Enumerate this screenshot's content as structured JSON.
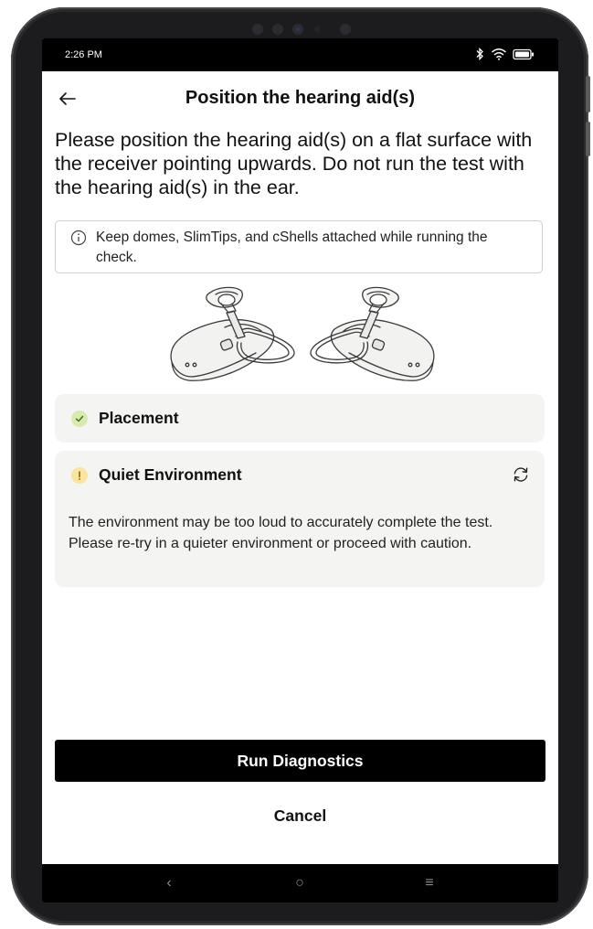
{
  "status_bar": {
    "time": "2:26 PM",
    "icons": [
      "bluetooth-icon",
      "wifi-icon",
      "battery-icon"
    ]
  },
  "header": {
    "back_icon": "arrow-left-icon",
    "title": "Position the hearing aid(s)"
  },
  "instructions": "Please position the hearing aid(s) on a flat surface with the receiver pointing upwards. Do not run the test with the hearing aid(s) in the ear.",
  "info": {
    "icon": "info-icon",
    "text": "Keep domes, SlimTips, and cShells attached while running the check."
  },
  "checks": [
    {
      "title": "Placement",
      "status": "passed",
      "status_icon": "check-icon",
      "status_color": "#d8eab0"
    },
    {
      "title": "Quiet Environment",
      "status": "warning",
      "status_icon": "exclamation-icon",
      "status_color": "#fbe3a0",
      "action_icon": "refresh-icon",
      "description": "The environment may be too loud to accurately complete the test. Please re-try in a quieter environment or proceed with caution."
    }
  ],
  "actions": {
    "primary_label": "Run Diagnostics",
    "secondary_label": "Cancel"
  },
  "nav_bar": {
    "back": "‹",
    "home": "○",
    "recents": "≡"
  },
  "colors": {
    "primary_button": "#000000",
    "card_background": "#f4f4f3",
    "success": "#d8eab0",
    "warning": "#fbe3a0"
  }
}
